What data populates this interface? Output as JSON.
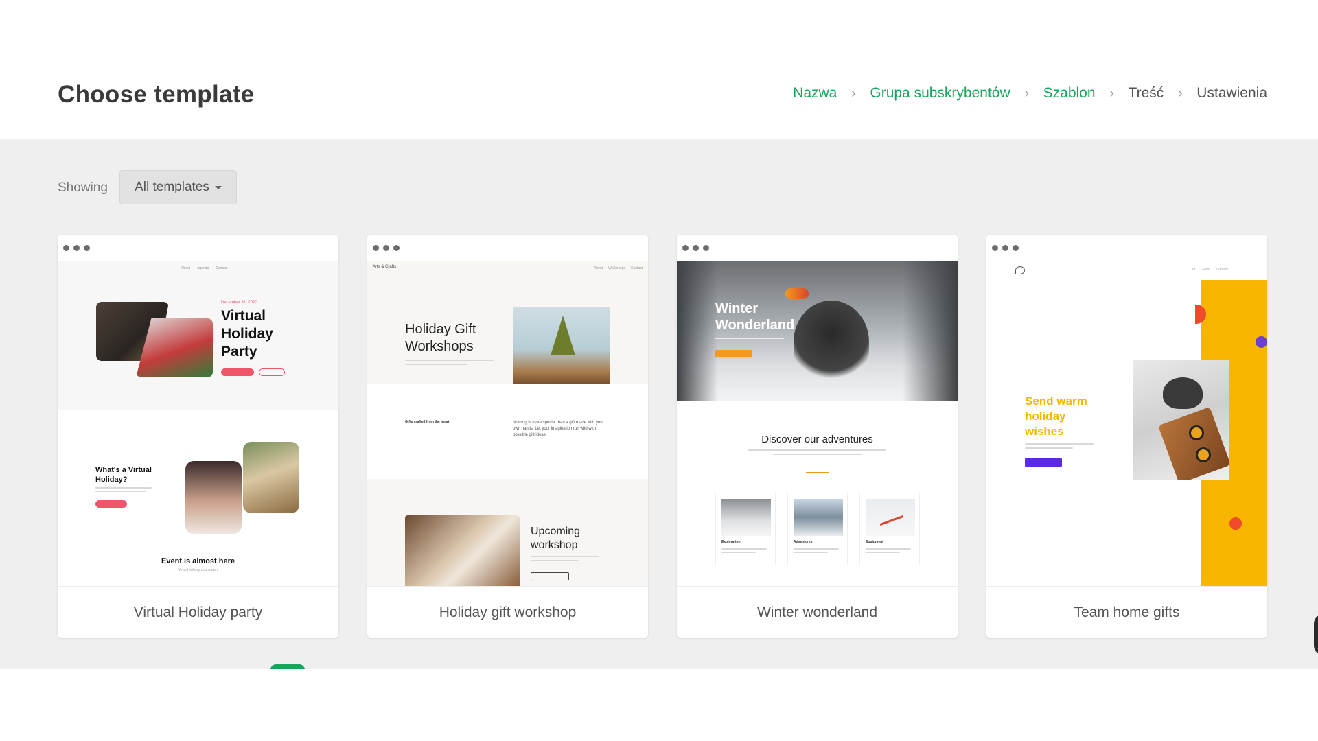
{
  "page": {
    "title": "Choose template"
  },
  "breadcrumb": [
    {
      "label": "Nazwa",
      "state": "done"
    },
    {
      "label": "Grupa subskrybentów",
      "state": "done"
    },
    {
      "label": "Szablon",
      "state": "done"
    },
    {
      "label": "Treść",
      "state": "todo"
    },
    {
      "label": "Ustawienia",
      "state": "todo"
    }
  ],
  "filter": {
    "showing_label": "Showing",
    "selected": "All templates"
  },
  "templates": [
    {
      "name": "Virtual Holiday party",
      "preview": {
        "nav": [
          "About",
          "Agenda",
          "Contact"
        ],
        "date": "December 31, 2020",
        "headline": "Virtual Holiday Party",
        "section_title": "What's a Virtual Holiday?",
        "footer_title": "Event is almost here",
        "footer_sub": "Virtual holiday countdown"
      }
    },
    {
      "name": "Holiday gift workshop",
      "preview": {
        "brand": "Arts & Crafts",
        "nav": [
          "About",
          "Workshops",
          "Contact"
        ],
        "headline": "Holiday Gift Workshops",
        "tagline": "Gifts crafted from the heart",
        "body": "Nothing is more special than a gift made with your own hands. Let your imagination run wild with possible gift ideas.",
        "upcoming": "Upcoming workshop"
      }
    },
    {
      "name": "Winter wonderland",
      "preview": {
        "headline": "Winter Wonderland",
        "section_title": "Discover our adventures",
        "items": [
          "Exploration",
          "Adventures",
          "Equipment"
        ]
      }
    },
    {
      "name": "Team home gifts",
      "preview": {
        "nav": [
          "Our",
          "Gifts",
          "Contact"
        ],
        "headline": "Send warm holiday wishes"
      }
    }
  ],
  "colors": {
    "accent_green": "#17a55b",
    "party_red": "#f0566a",
    "winter_orange": "#f39a1e",
    "gifts_yellow": "#f7b500",
    "gifts_purple": "#5b2be0"
  },
  "icons": {
    "breadcrumb_separator": "chevron-right-icon",
    "dropdown": "caret-down-icon"
  }
}
